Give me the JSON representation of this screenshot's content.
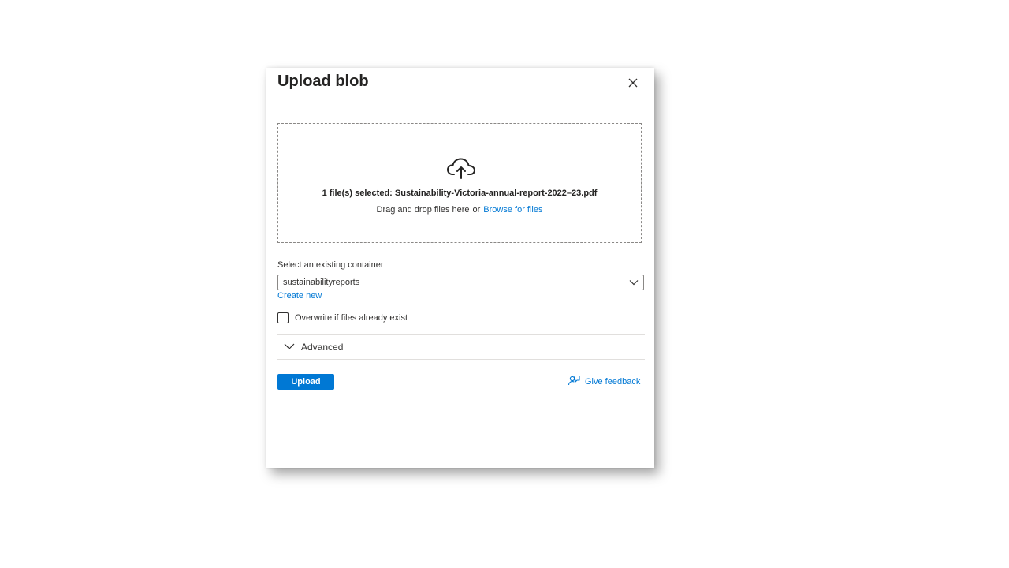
{
  "dialog": {
    "title": "Upload blob",
    "close_icon": "close-icon"
  },
  "dropzone": {
    "icon": "cloud-upload-icon",
    "selected_text": "1 file(s) selected: Sustainability-Victoria-annual-report-2022–23.pdf",
    "drag_text": "Drag and drop files here",
    "or_text": "or",
    "browse_link": "Browse for files"
  },
  "container": {
    "label": "Select an existing container",
    "selected_value": "sustainabilityreports",
    "create_new_link": "Create new"
  },
  "overwrite": {
    "label": "Overwrite if files already exist",
    "checked": false
  },
  "advanced": {
    "label": "Advanced",
    "expanded": false
  },
  "actions": {
    "upload_label": "Upload",
    "feedback_label": "Give feedback",
    "feedback_icon": "feedback-icon"
  },
  "colors": {
    "accent": "#0078d4",
    "text": "#323130",
    "border": "#8a8886"
  }
}
